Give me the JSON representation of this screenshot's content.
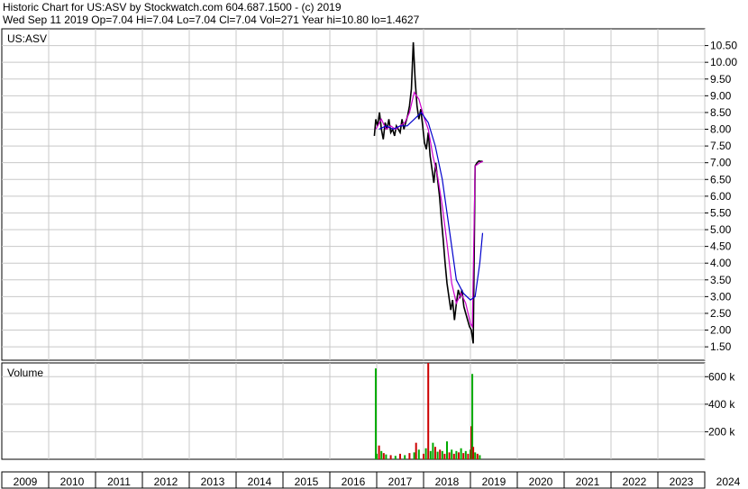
{
  "header": {
    "line1": "Historic Chart for US:ASV by Stockwatch.com 604.687.1500 - (c) 2019",
    "line2": "Wed Sep 11 2019   Op=7.04   Hi=7.04   Lo=7.04   Cl=7.04   Vol=271   Year hi=10.80   lo=1.4627"
  },
  "chart_data": [
    {
      "type": "line",
      "title": "US:ASV",
      "x_axis": [
        "2009",
        "2010",
        "2011",
        "2012",
        "2013",
        "2014",
        "2015",
        "2016",
        "2017",
        "2018",
        "2019",
        "2020",
        "2021",
        "2022",
        "2023",
        "2024"
      ],
      "y_ticks": [
        "10.50",
        "10.00",
        "9.50",
        "9.00",
        "8.50",
        "8.00",
        "7.50",
        "7.00",
        "6.50",
        "6.00",
        "5.50",
        "5.00",
        "4.50",
        "4.00",
        "3.50",
        "3.00",
        "2.50",
        "2.00",
        "1.50"
      ],
      "ylim": [
        1.1,
        11.0
      ],
      "grid": true,
      "colors": {
        "price": "#000000",
        "ma_short": "#cc00cc",
        "ma_long": "#0000cc"
      },
      "series": [
        {
          "values_role": "price",
          "x": [
            2016.95,
            2016.98,
            2017.02,
            2017.06,
            2017.1,
            2017.14,
            2017.18,
            2017.22,
            2017.26,
            2017.3,
            2017.34,
            2017.38,
            2017.42,
            2017.46,
            2017.5,
            2017.54,
            2017.58,
            2017.62,
            2017.66,
            2017.7,
            2017.74,
            2017.78,
            2017.82,
            2017.86,
            2017.9,
            2017.94,
            2017.98,
            2018.02,
            2018.06,
            2018.1,
            2018.14,
            2018.18,
            2018.22,
            2018.26,
            2018.3,
            2018.34,
            2018.38,
            2018.42,
            2018.46,
            2018.5,
            2018.54,
            2018.58,
            2018.62,
            2018.66,
            2018.7,
            2018.74,
            2018.78,
            2018.82,
            2018.86,
            2018.9,
            2018.94,
            2018.98,
            2019.02,
            2019.06,
            2019.1,
            2019.14,
            2019.18,
            2019.22,
            2019.26
          ],
          "values": [
            7.8,
            8.3,
            8.1,
            8.5,
            8.0,
            7.7,
            8.2,
            8.0,
            8.3,
            7.9,
            8.0,
            7.8,
            8.1,
            8.0,
            7.9,
            8.3,
            8.0,
            8.2,
            8.4,
            8.7,
            9.2,
            10.6,
            9.5,
            8.7,
            8.3,
            8.6,
            8.1,
            7.6,
            7.4,
            7.9,
            7.2,
            6.8,
            6.4,
            7.0,
            6.5,
            6.0,
            5.3,
            4.7,
            4.0,
            3.4,
            3.0,
            2.6,
            2.9,
            2.3,
            2.8,
            3.2,
            3.0,
            3.2,
            2.7,
            2.5,
            2.3,
            2.1,
            2.0,
            1.6,
            6.9,
            7.0,
            7.05,
            7.04,
            7.04
          ]
        },
        {
          "values_role": "ma_short",
          "x": [
            2016.98,
            2017.1,
            2017.2,
            2017.3,
            2017.4,
            2017.5,
            2017.6,
            2017.7,
            2017.8,
            2017.9,
            2018.0,
            2018.1,
            2018.2,
            2018.3,
            2018.4,
            2018.5,
            2018.6,
            2018.7,
            2018.8,
            2018.9,
            2019.0,
            2019.04,
            2019.1,
            2019.2,
            2019.27
          ],
          "values": [
            8.0,
            8.3,
            8.0,
            8.1,
            8.0,
            8.1,
            8.2,
            8.5,
            9.1,
            8.9,
            8.4,
            8.0,
            7.2,
            6.6,
            5.7,
            4.6,
            3.4,
            2.8,
            3.1,
            2.8,
            2.2,
            2.1,
            6.9,
            7.0,
            7.04
          ]
        },
        {
          "values_role": "ma_long",
          "x": [
            2017.05,
            2017.2,
            2017.35,
            2017.5,
            2017.65,
            2017.8,
            2017.95,
            2018.1,
            2018.25,
            2018.4,
            2018.55,
            2018.7,
            2018.85,
            2019.0,
            2019.1,
            2019.2,
            2019.26
          ],
          "values": [
            8.0,
            8.1,
            8.0,
            8.1,
            8.1,
            8.3,
            8.5,
            8.2,
            7.5,
            6.5,
            5.0,
            3.5,
            3.1,
            2.9,
            3.0,
            4.0,
            4.9
          ]
        }
      ]
    },
    {
      "type": "bar",
      "title": "Volume",
      "y_ticks": [
        "600 k",
        "400 k",
        "200 k"
      ],
      "ylim": [
        0,
        700
      ],
      "grid": true,
      "colors": {
        "up": "#00aa00",
        "down": "#cc0000"
      },
      "x": [
        2016.98,
        2017.0,
        2017.05,
        2017.1,
        2017.15,
        2017.2,
        2017.3,
        2017.4,
        2017.5,
        2017.6,
        2017.7,
        2017.8,
        2017.84,
        2017.9,
        2018.0,
        2018.05,
        2018.1,
        2018.15,
        2018.2,
        2018.25,
        2018.3,
        2018.35,
        2018.4,
        2018.45,
        2018.5,
        2018.55,
        2018.6,
        2018.65,
        2018.7,
        2018.75,
        2018.8,
        2018.85,
        2018.9,
        2018.95,
        2019.0,
        2019.02,
        2019.04,
        2019.06,
        2019.1,
        2019.15,
        2019.2
      ],
      "values": [
        660,
        40,
        100,
        60,
        45,
        35,
        30,
        25,
        40,
        30,
        45,
        50,
        120,
        70,
        40,
        80,
        700,
        60,
        120,
        90,
        55,
        70,
        60,
        40,
        130,
        50,
        70,
        40,
        60,
        50,
        80,
        45,
        60,
        40,
        70,
        240,
        620,
        90,
        50,
        40,
        30
      ],
      "dir": [
        "up",
        "up",
        "down",
        "up",
        "down",
        "up",
        "down",
        "up",
        "down",
        "up",
        "down",
        "up",
        "down",
        "up",
        "down",
        "up",
        "down",
        "up",
        "up",
        "down",
        "up",
        "down",
        "up",
        "down",
        "up",
        "down",
        "up",
        "down",
        "up",
        "down",
        "up",
        "down",
        "up",
        "down",
        "up",
        "down",
        "up",
        "down",
        "up",
        "down",
        "up"
      ]
    }
  ]
}
